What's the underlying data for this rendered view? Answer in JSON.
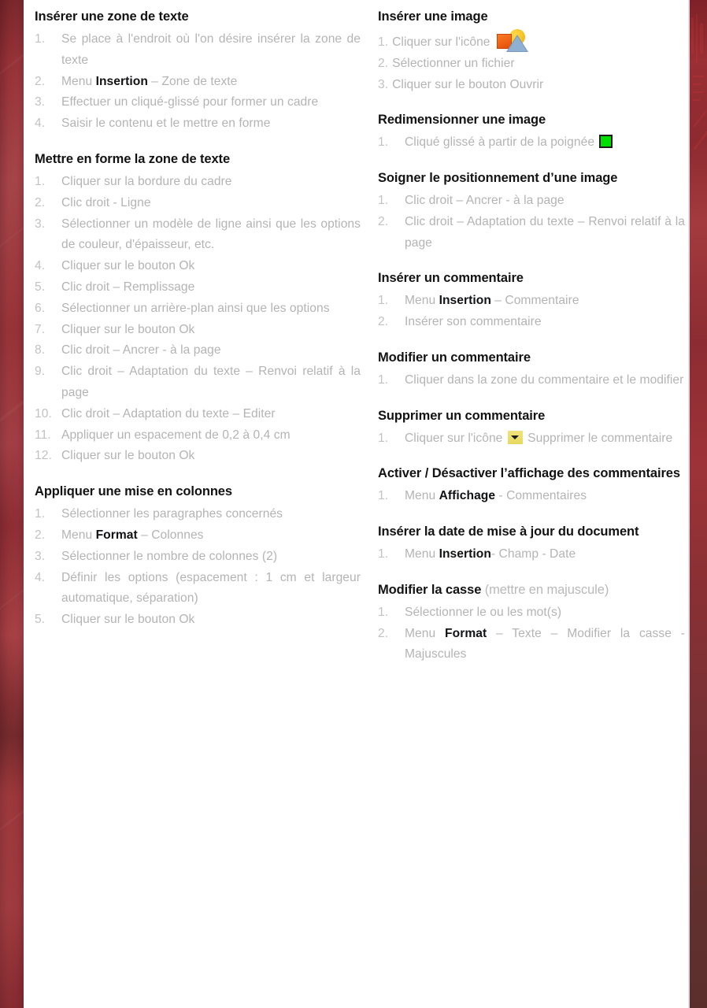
{
  "theme": {
    "page_background": "#ffffff",
    "edge_left_color": "#9b3138",
    "edge_right_color": "#8d2a30",
    "heading_color": "#131314",
    "body_color": "#b4b4b4",
    "icon_image_colors": [
      "#ef5f12",
      "#f7c324",
      "#8fb0d0"
    ],
    "icon_handle_color": "#00e000",
    "icon_dropdown_color": "#ece06f"
  },
  "left_column": [
    {
      "title": "Insérer une zone de texte",
      "steps": [
        {
          "parts": [
            {
              "text": "Se place à l'endroit où l'on désire insérer la zone de texte"
            }
          ]
        },
        {
          "parts": [
            {
              "text": "Menu "
            },
            {
              "text": "Insertion",
              "bold": true
            },
            {
              "text": " – Zone de texte"
            }
          ]
        },
        {
          "parts": [
            {
              "text": "Effectuer un cliqué-glissé pour former un cadre"
            }
          ]
        },
        {
          "parts": [
            {
              "text": "Saisir le contenu et le mettre en forme"
            }
          ]
        }
      ]
    },
    {
      "title": "Mettre en forme la zone de texte",
      "steps": [
        {
          "parts": [
            {
              "text": "Cliquer sur la bordure du cadre"
            }
          ]
        },
        {
          "parts": [
            {
              "text": "Clic droit - Ligne"
            }
          ]
        },
        {
          "parts": [
            {
              "text": "Sélectionner un modèle de ligne ainsi que les options de couleur, d'épaisseur, etc."
            }
          ]
        },
        {
          "parts": [
            {
              "text": "Cliquer sur le bouton Ok"
            }
          ]
        },
        {
          "parts": [
            {
              "text": "Clic droit – Remplissage"
            }
          ]
        },
        {
          "parts": [
            {
              "text": "Sélectionner un arrière-plan ainsi que les options"
            }
          ]
        },
        {
          "parts": [
            {
              "text": "Cliquer sur le bouton Ok"
            }
          ]
        },
        {
          "parts": [
            {
              "text": "Clic droit – Ancrer - à la page"
            }
          ]
        },
        {
          "parts": [
            {
              "text": "Clic droit – Adaptation du texte – Renvoi relatif à la page"
            }
          ]
        },
        {
          "parts": [
            {
              "text": "Clic droit – Adaptation du texte – Editer"
            }
          ]
        },
        {
          "parts": [
            {
              "text": "Appliquer un espacement de 0,2 à 0,4 cm"
            }
          ]
        },
        {
          "parts": [
            {
              "text": "Cliquer sur le bouton Ok"
            }
          ]
        }
      ]
    },
    {
      "title": "Appliquer une mise en colonnes",
      "steps": [
        {
          "parts": [
            {
              "text": "Sélectionner les paragraphes concernés"
            }
          ]
        },
        {
          "parts": [
            {
              "text": "Menu "
            },
            {
              "text": "Format",
              "bold": true
            },
            {
              "text": " – Colonnes"
            }
          ]
        },
        {
          "parts": [
            {
              "text": "Sélectionner le nombre de colonnes (2)"
            }
          ]
        },
        {
          "parts": [
            {
              "text": "Définir les options (espacement : 1 cm et largeur automatique, séparation)"
            }
          ]
        },
        {
          "parts": [
            {
              "text": "Cliquer sur le bouton Ok"
            }
          ]
        }
      ]
    }
  ],
  "right_column": [
    {
      "title": "Insérer une image",
      "tight": true,
      "steps": [
        {
          "parts": [
            {
              "text": "Cliquer sur l'icône "
            },
            {
              "icon": "image-insert-icon"
            }
          ]
        },
        {
          "parts": [
            {
              "text": "Sélectionner un fichier"
            }
          ]
        },
        {
          "parts": [
            {
              "text": "Cliquer sur le bouton Ouvrir"
            }
          ]
        }
      ]
    },
    {
      "title": "Redimensionner une image",
      "steps": [
        {
          "parts": [
            {
              "text": "Cliqué glissé à partir de la poignée "
            },
            {
              "icon": "green-handle-icon"
            }
          ]
        }
      ]
    },
    {
      "title": "Soigner le positionnement d’une image",
      "steps": [
        {
          "parts": [
            {
              "text": "Clic droit – Ancrer - à la page"
            }
          ]
        },
        {
          "parts": [
            {
              "text": "Clic droit – Adaptation du texte – Renvoi relatif à la page"
            }
          ]
        }
      ]
    },
    {
      "title": "Insérer un commentaire",
      "steps": [
        {
          "parts": [
            {
              "text": "Menu "
            },
            {
              "text": "Insertion",
              "bold": true
            },
            {
              "text": " – Commentaire"
            }
          ]
        },
        {
          "parts": [
            {
              "text": "Insérer son commentaire"
            }
          ]
        }
      ]
    },
    {
      "title": "Modifier un commentaire",
      "steps": [
        {
          "parts": [
            {
              "text": "Cliquer dans la zone du commentaire et le modifier"
            }
          ]
        }
      ]
    },
    {
      "title": "Supprimer un commentaire",
      "steps": [
        {
          "parts": [
            {
              "text": "Cliquer sur l'icône "
            },
            {
              "icon": "dropdown-arrow-icon"
            },
            {
              "text": " Supprimer le commentaire"
            }
          ]
        }
      ]
    },
    {
      "title": "Activer / Désactiver l’affichage des commentaires",
      "steps": [
        {
          "parts": [
            {
              "text": "Menu "
            },
            {
              "text": "Affichage",
              "bold": true
            },
            {
              "text": " - Commentaires"
            }
          ]
        }
      ]
    },
    {
      "title": "Insérer la date de mise à jour du document",
      "steps": [
        {
          "parts": [
            {
              "text": "Menu "
            },
            {
              "text": "Insertion",
              "bold": true
            },
            {
              "text": "- Champ - Date"
            }
          ]
        }
      ]
    },
    {
      "title": "Modifier la casse",
      "title_note": " (mettre en majuscule)",
      "steps": [
        {
          "parts": [
            {
              "text": "Sélectionner le ou les mot(s)"
            }
          ]
        },
        {
          "parts": [
            {
              "text": "Menu "
            },
            {
              "text": "Format",
              "bold": true
            },
            {
              "text": " – Texte – Modifier la casse - Majuscules"
            }
          ]
        }
      ]
    }
  ]
}
